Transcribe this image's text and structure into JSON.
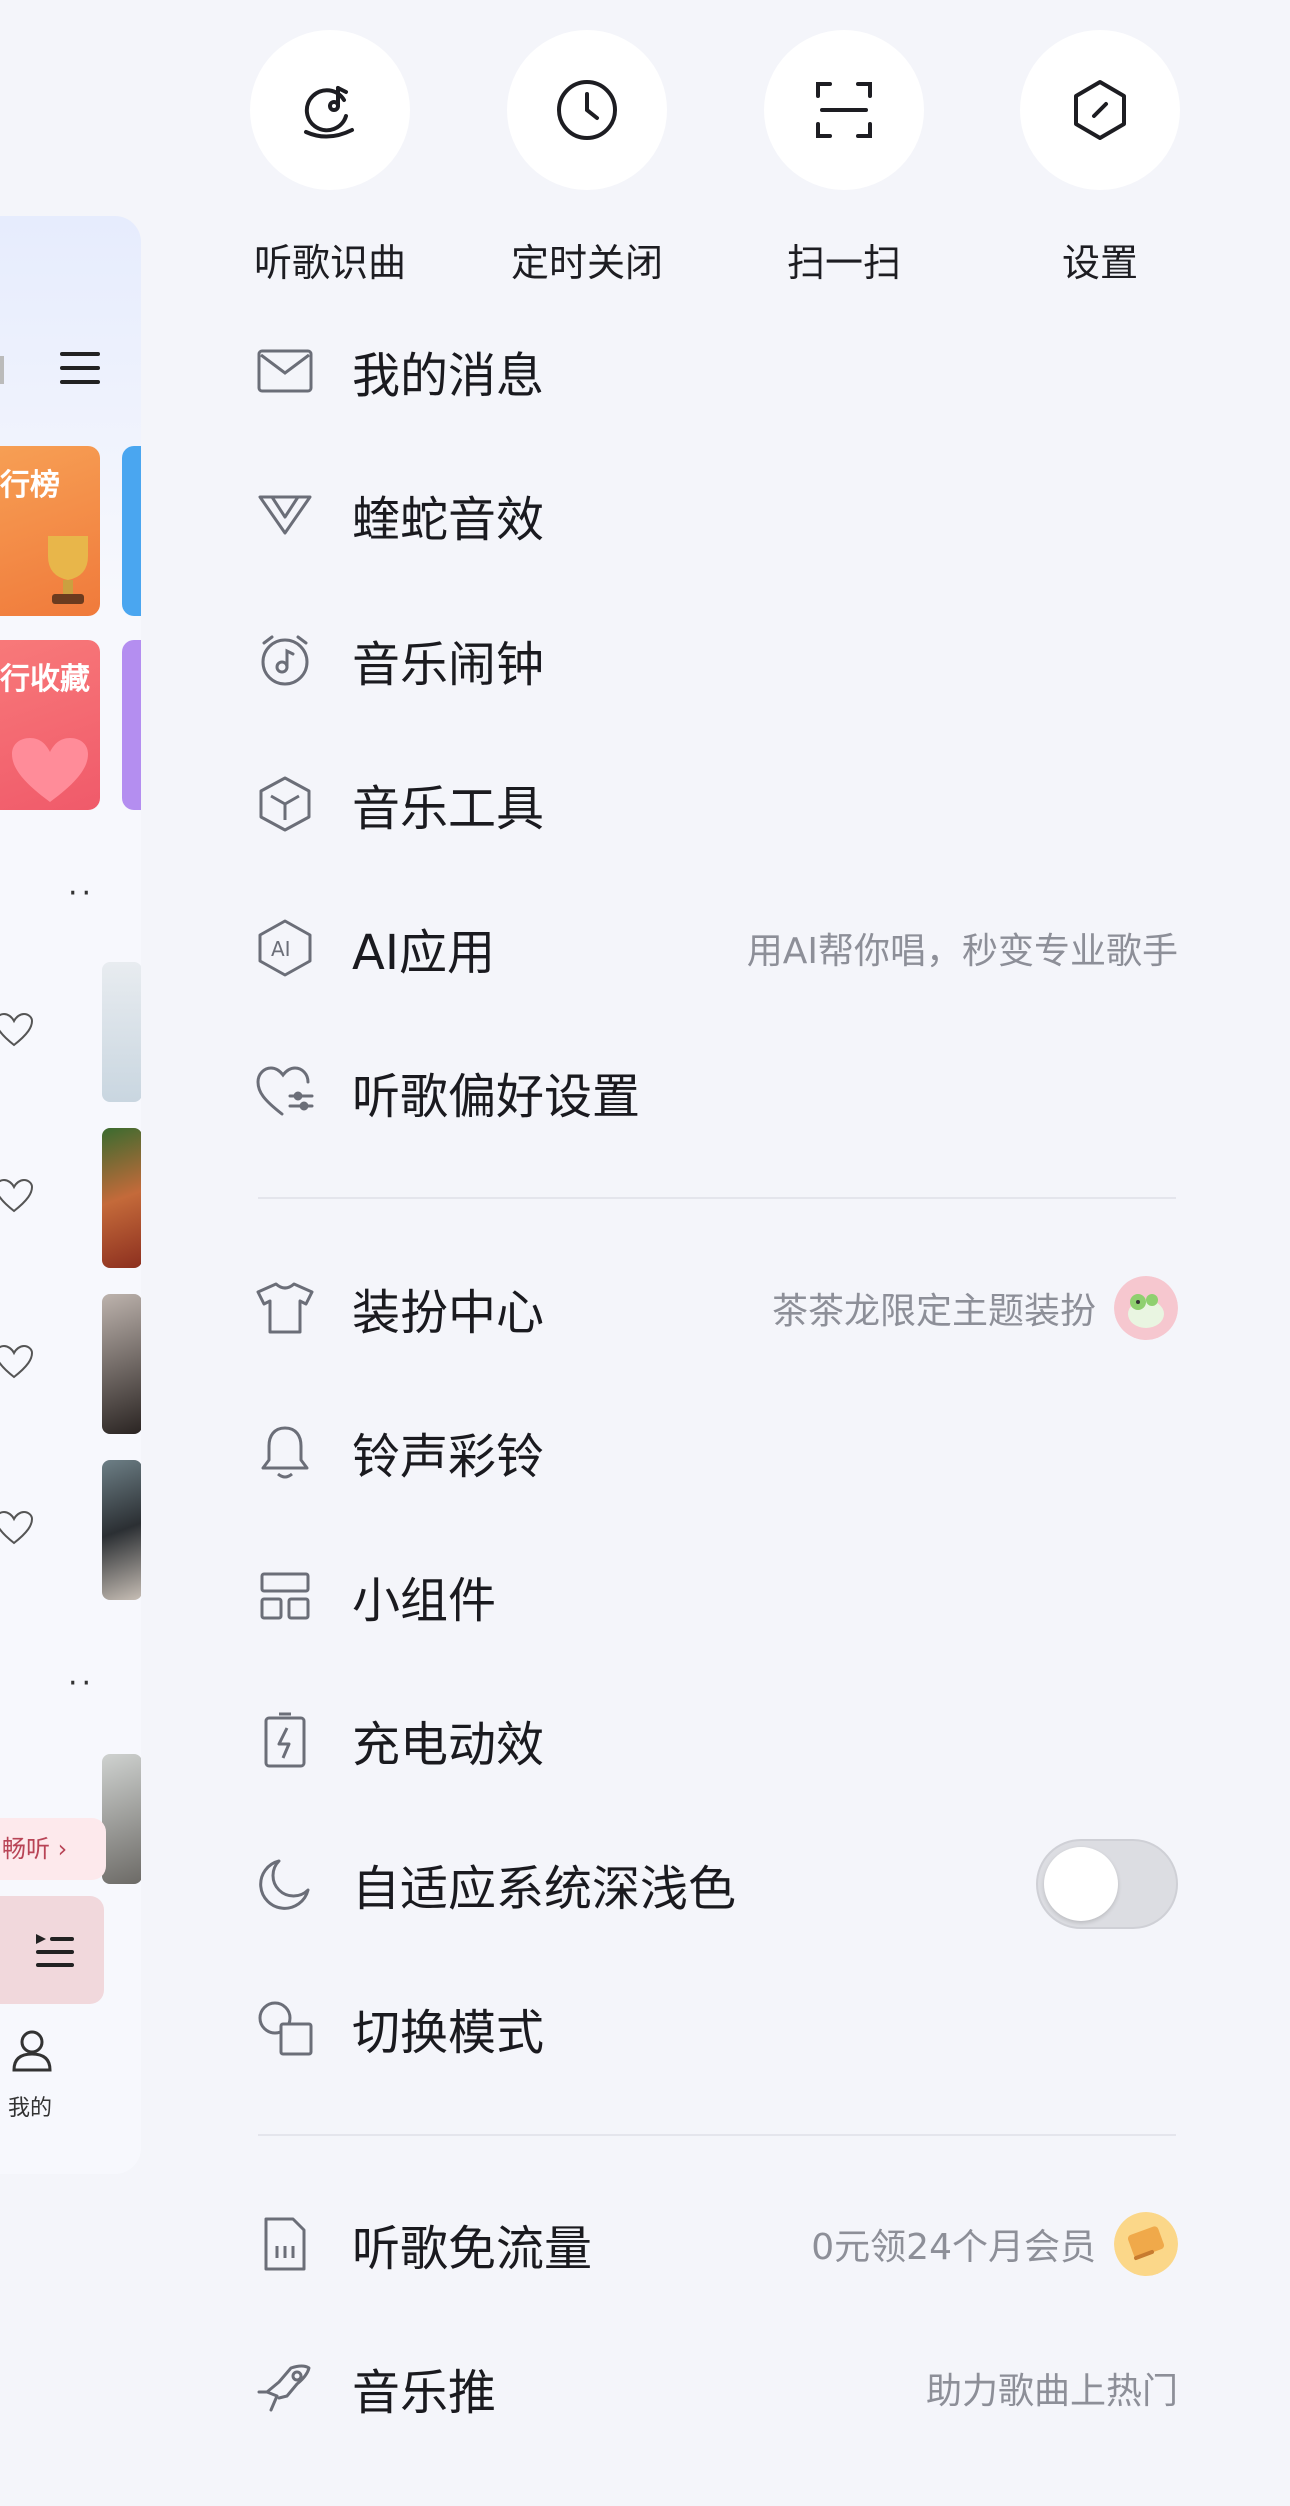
{
  "background_app": {
    "tile_labels": [
      "行榜",
      "行收藏"
    ],
    "promo_text": "畅听",
    "nav_mine_label": "我的"
  },
  "quick_actions": [
    {
      "label": "听歌识曲",
      "icon": "music-recognition-icon"
    },
    {
      "label": "定时关闭",
      "icon": "clock-icon"
    },
    {
      "label": "扫一扫",
      "icon": "scan-icon"
    },
    {
      "label": "设置",
      "icon": "settings-hexagon-icon"
    }
  ],
  "menu": {
    "messages": {
      "label": "我的消息",
      "icon": "mail-icon"
    },
    "viper_sound": {
      "label": "蝰蛇音效",
      "icon": "viper-icon"
    },
    "music_alarm": {
      "label": "音乐闹钟",
      "icon": "alarm-icon"
    },
    "music_tools": {
      "label": "音乐工具",
      "icon": "cube-icon"
    },
    "ai_apps": {
      "label": "AI应用",
      "subtitle": "用AI帮你唱，秒变专业歌手",
      "icon": "ai-hexagon-icon"
    },
    "listening_prefs": {
      "label": "听歌偏好设置",
      "icon": "heart-sliders-icon"
    },
    "theme_center": {
      "label": "装扮中心",
      "subtitle": "茶茶龙限定主题装扮",
      "icon": "tshirt-icon"
    },
    "ringtones": {
      "label": "铃声彩铃",
      "icon": "bell-icon"
    },
    "widgets": {
      "label": "小组件",
      "icon": "widgets-icon"
    },
    "charging_effect": {
      "label": "充电动效",
      "icon": "battery-charge-icon"
    },
    "dark_mode": {
      "label": "自适应系统深浅色",
      "icon": "moon-icon",
      "enabled": false
    },
    "switch_mode": {
      "label": "切换模式",
      "icon": "shapes-icon"
    },
    "free_data": {
      "label": "听歌免流量",
      "subtitle": "0元领24个月会员",
      "icon": "sim-card-icon"
    },
    "music_promote": {
      "label": "音乐推",
      "subtitle": "助力歌曲上热门",
      "icon": "rocket-hand-icon"
    }
  },
  "colors": {
    "drawer_bg": "#f4f5fa",
    "icon_stroke": "#6b6e78",
    "subtitle": "#8d8f98",
    "toggle_off": "#dcdde2"
  }
}
